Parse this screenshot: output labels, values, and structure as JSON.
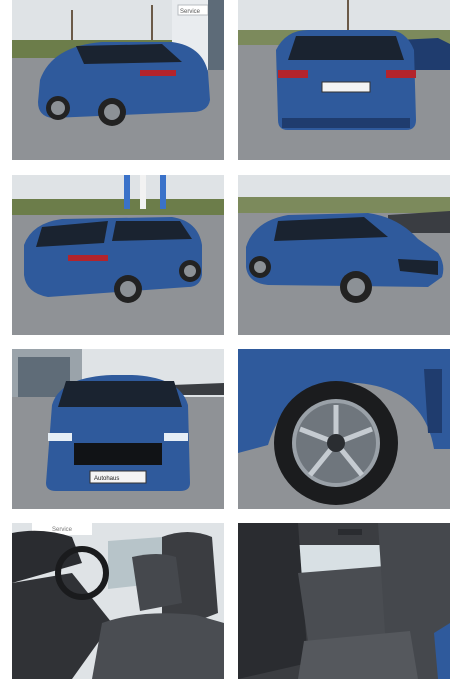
{
  "gallery": {
    "photos": [
      {
        "id": 1,
        "view": "rear-left three-quarter",
        "sign_text": "Service"
      },
      {
        "id": 2,
        "view": "rear"
      },
      {
        "id": 3,
        "view": "rear-left three-quarter"
      },
      {
        "id": 4,
        "view": "front-left three-quarter"
      },
      {
        "id": 5,
        "view": "front",
        "plate_text": "Autohaus"
      },
      {
        "id": 6,
        "view": "alloy wheel detail"
      },
      {
        "id": 7,
        "view": "front seats interior",
        "sign_text": "Service"
      },
      {
        "id": 8,
        "view": "rear seats interior"
      }
    ]
  },
  "colors": {
    "car_body": "#2f5a9c",
    "car_dark": "#1f3c6e",
    "sky": "#dfe3e6",
    "asphalt": "#8f9296",
    "grass": "#6c7d4a",
    "interior": "#3b3d41"
  }
}
